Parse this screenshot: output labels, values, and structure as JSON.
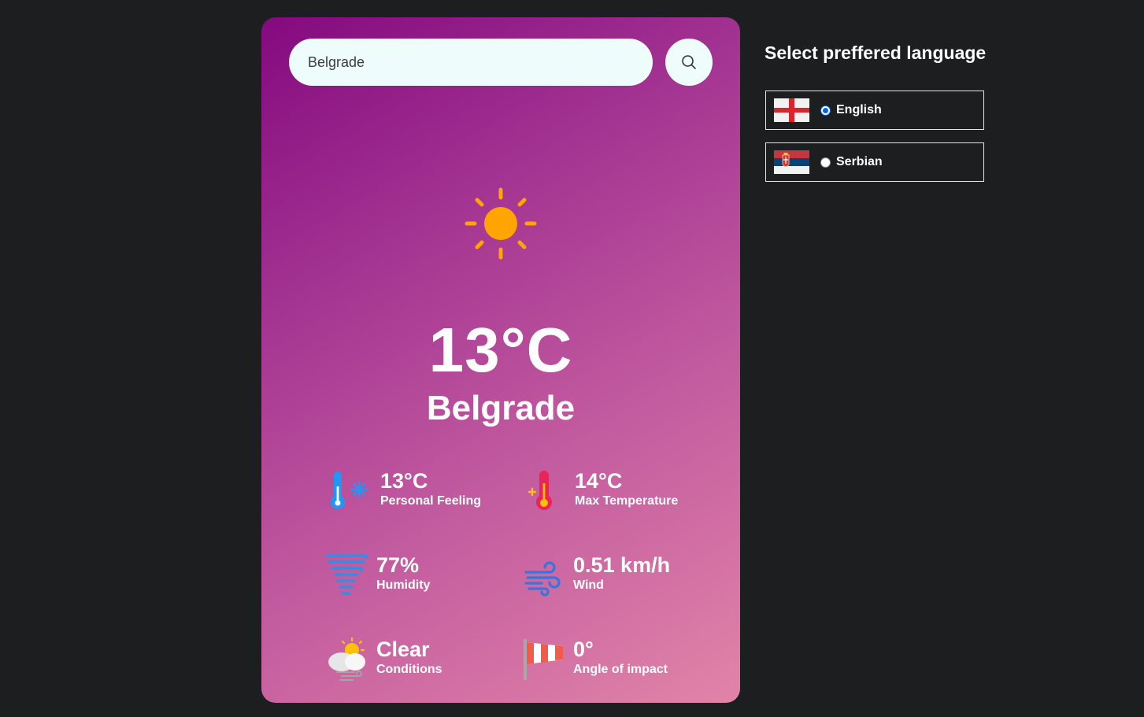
{
  "search": {
    "value": "Belgrade"
  },
  "weather": {
    "icon": "sun-icon",
    "temperature": "13°C",
    "city": "Belgrade"
  },
  "stats": {
    "feels_like": {
      "value": "13°C",
      "label": "Personal Feeling",
      "icon": "thermometer-cold-icon"
    },
    "max_temp": {
      "value": "14°C",
      "label": "Max Temperature",
      "icon": "thermometer-hot-icon"
    },
    "humidity": {
      "value": "77%",
      "label": "Humidity",
      "icon": "humidity-icon"
    },
    "wind": {
      "value": "0.51 km/h",
      "label": "Wind",
      "icon": "wind-icon"
    },
    "conditions": {
      "value": "Clear",
      "label": "Conditions",
      "icon": "partly-cloudy-icon"
    },
    "wind_angle": {
      "value": "0°",
      "label": "Angle of impact",
      "icon": "windsock-icon"
    }
  },
  "language": {
    "title": "Select preffered language",
    "options": [
      {
        "label": "English",
        "flag": "england-flag-icon",
        "selected": true
      },
      {
        "label": "Serbian",
        "flag": "serbia-flag-icon",
        "selected": false
      }
    ]
  },
  "colors": {
    "background": "#1d1e20",
    "card_gradient_start": "#84097f",
    "card_gradient_end": "#e184a8",
    "input_background": "#eefdfb",
    "sun": "#ffa400"
  }
}
